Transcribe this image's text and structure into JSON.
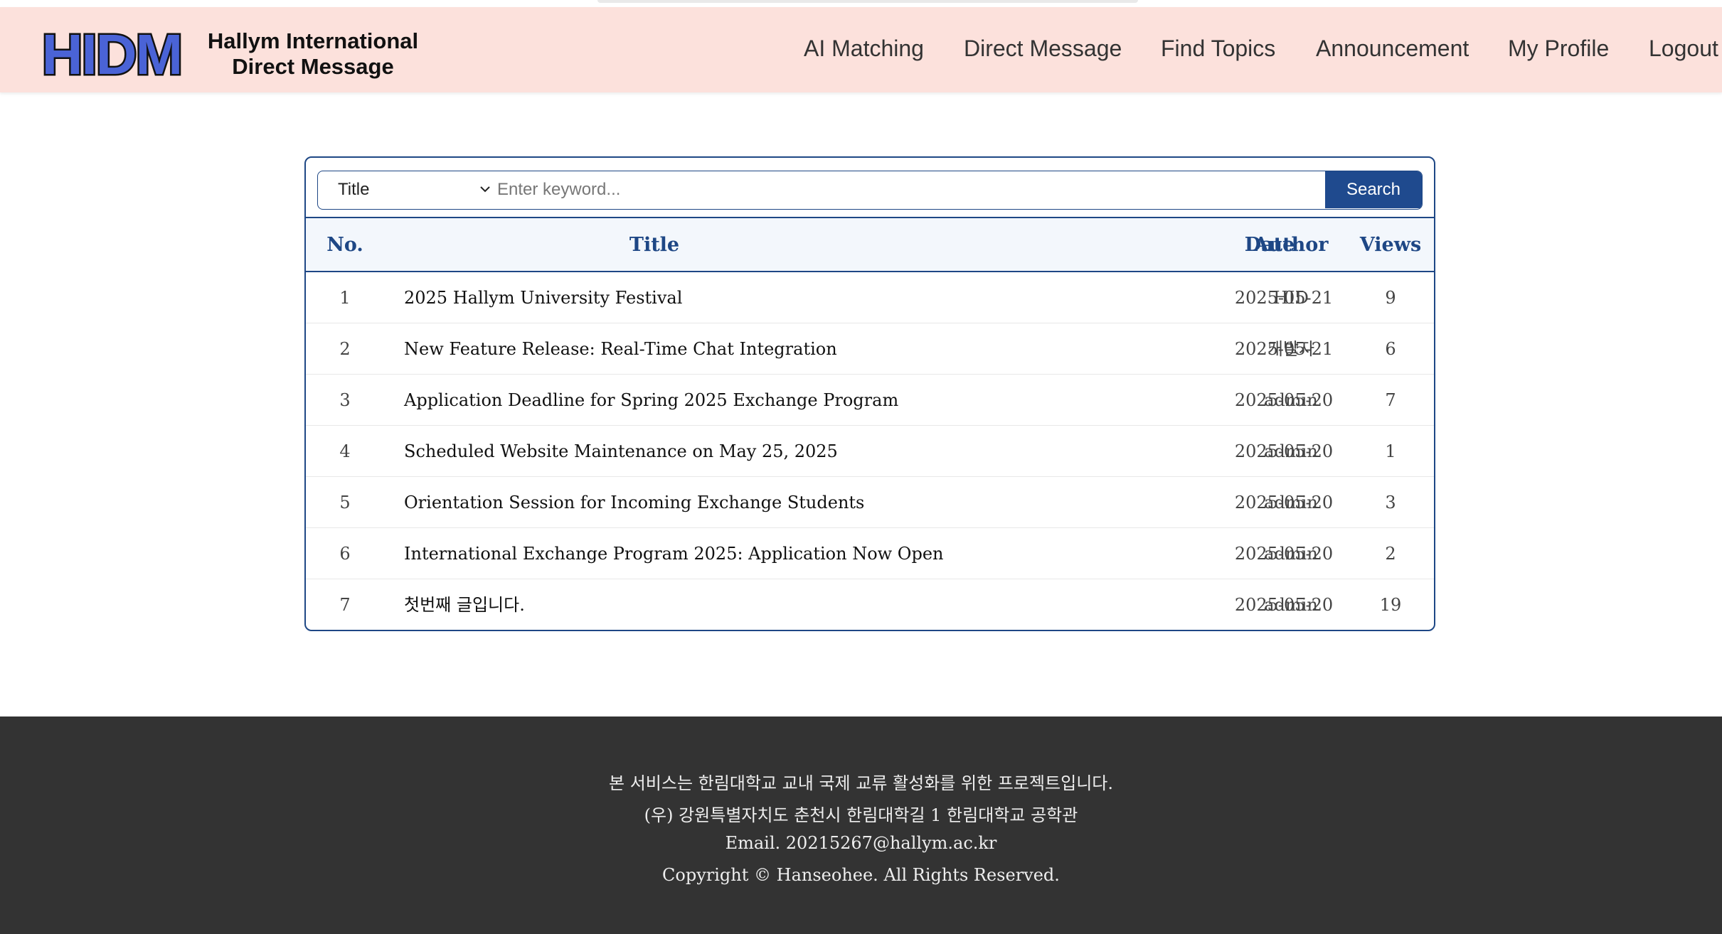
{
  "brand": {
    "logo_text": "HIDM",
    "name_line1": "Hallym International",
    "name_line2": "Direct Message"
  },
  "nav": {
    "items": [
      "AI Matching",
      "Direct Message",
      "Find Topics",
      "Announcement",
      "My Profile",
      "Logout"
    ]
  },
  "search": {
    "selected_field": "Title",
    "placeholder": "Enter keyword...",
    "button_label": "Search"
  },
  "table": {
    "headers": {
      "no": "No.",
      "title": "Title",
      "author": "Author",
      "date": "Date",
      "views": "Views"
    },
    "rows": [
      {
        "no": "1",
        "title": "2025 Hallym University Festival",
        "author": "HID",
        "date": "2025-05-21",
        "views": "9"
      },
      {
        "no": "2",
        "title": "New Feature Release: Real-Time Chat Integration",
        "author": "개발자",
        "date": "2025-05-21",
        "views": "6"
      },
      {
        "no": "3",
        "title": "Application Deadline for Spring 2025 Exchange Program",
        "author": "admin",
        "date": "2025-05-20",
        "views": "7"
      },
      {
        "no": "4",
        "title": "Scheduled Website Maintenance on May 25, 2025",
        "author": "admin",
        "date": "2025-05-20",
        "views": "1"
      },
      {
        "no": "5",
        "title": "Orientation Session for Incoming Exchange Students",
        "author": "admin",
        "date": "2025-05-20",
        "views": "3"
      },
      {
        "no": "6",
        "title": "International Exchange Program 2025: Application Now Open",
        "author": "admin",
        "date": "2025-05-20",
        "views": "2"
      },
      {
        "no": "7",
        "title": "첫번째 글입니다.",
        "author": "admin",
        "date": "2025-05-20",
        "views": "19"
      }
    ]
  },
  "footer": {
    "line1": "본 서비스는 한림대학교 교내 국제 교류 활성화를 위한 프로젝트입니다.",
    "line2": "(우) 강원특별자치도 춘천시 한림대학길 1 한림대학교 공학관",
    "line3": "Email. 20215267@hallym.ac.kr",
    "line4": "Copyright © Hanseohee. All Rights Reserved."
  },
  "colors": {
    "header_bg": "#fce1dc",
    "accent": "#1e4785",
    "logo_fill": "#4a63d6",
    "footer_bg": "#333333"
  }
}
